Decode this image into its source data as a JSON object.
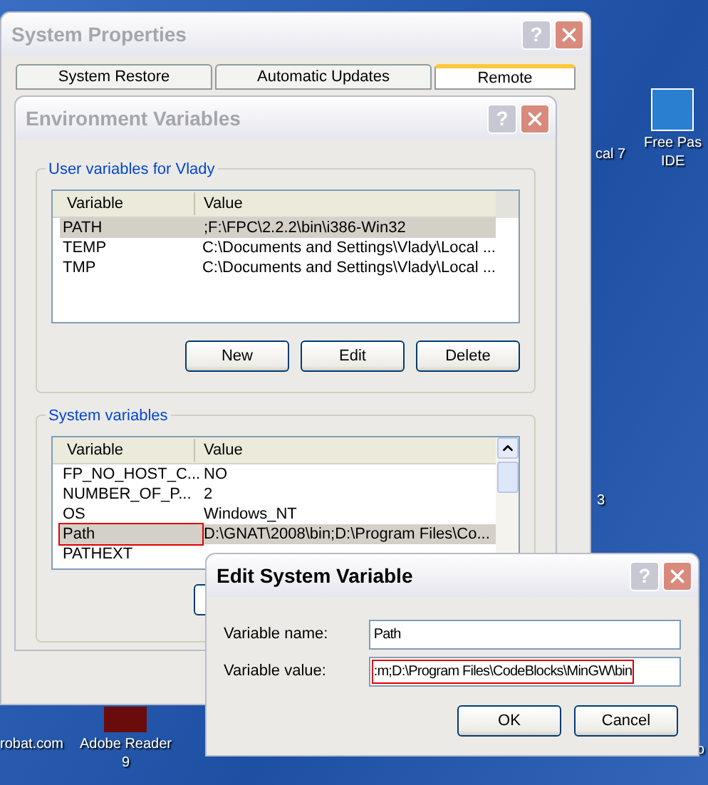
{
  "desktop_icons": [
    {
      "label": "cal 7",
      "kind": "plain"
    },
    {
      "label": "Free Pas\nIDE",
      "kind": "pascal"
    },
    {
      "label": "3",
      "kind": "plain"
    },
    {
      "label": "robat.com",
      "kind": "plain"
    },
    {
      "label": "Adobe Reader\n9",
      "kind": "reader"
    },
    {
      "label": "o",
      "kind": "plain"
    }
  ],
  "system_properties": {
    "title": "System Properties",
    "help": "?",
    "tabs": [
      {
        "label": "System Restore",
        "selected": false
      },
      {
        "label": "Automatic Updates",
        "selected": false
      },
      {
        "label": "Remote",
        "selected": true
      }
    ]
  },
  "environment_variables": {
    "title": "Environment Variables",
    "help": "?",
    "user_group": {
      "title": "User variables for Vlady",
      "columns": [
        "Variable",
        "Value"
      ],
      "rows": [
        {
          "cells": [
            ";F:\\FPC\\2.2.2\\bin\\i386-Win32"
          ],
          "name": "PATH",
          "selected": true,
          "annotated": false
        },
        {
          "name": "TEMP",
          "cells": [
            "C:\\Documents and Settings\\Vlady\\Local ..."
          ],
          "selected": false,
          "annotated": false
        },
        {
          "name": "TMP",
          "cells": [
            "C:\\Documents and Settings\\Vlady\\Local ..."
          ],
          "selected": false,
          "annotated": false
        }
      ],
      "buttons": [
        "New",
        "Edit",
        "Delete"
      ]
    },
    "system_group": {
      "title": "System variables",
      "columns": [
        "Variable",
        "Value"
      ],
      "rows": [
        {
          "name": "FP_NO_HOST_C...",
          "cells": [
            "NO"
          ],
          "selected": false,
          "annotated": false
        },
        {
          "name": "NUMBER_OF_P...",
          "cells": [
            "2"
          ],
          "selected": false,
          "annotated": false
        },
        {
          "name": "OS",
          "cells": [
            "Windows_NT"
          ],
          "selected": false,
          "annotated": false
        },
        {
          "name": "Path",
          "cells": [
            "D:\\GNAT\\2008\\bin;D:\\Program Files\\Co..."
          ],
          "selected": true,
          "annotated": true
        },
        {
          "name": "PATHEXT",
          "cells": [],
          "selected": false,
          "annotated": false
        }
      ]
    }
  },
  "edit_dialog": {
    "title": "Edit System Variable",
    "help": "?",
    "fields": [
      {
        "label": "Variable name:",
        "value": "Path",
        "annotated": false
      },
      {
        "label": "Variable value:",
        "value": ":m;D:\\Program Files\\CodeBlocks\\MinGW\\bin",
        "annotated": true
      }
    ],
    "buttons": [
      "OK",
      "Cancel"
    ]
  }
}
